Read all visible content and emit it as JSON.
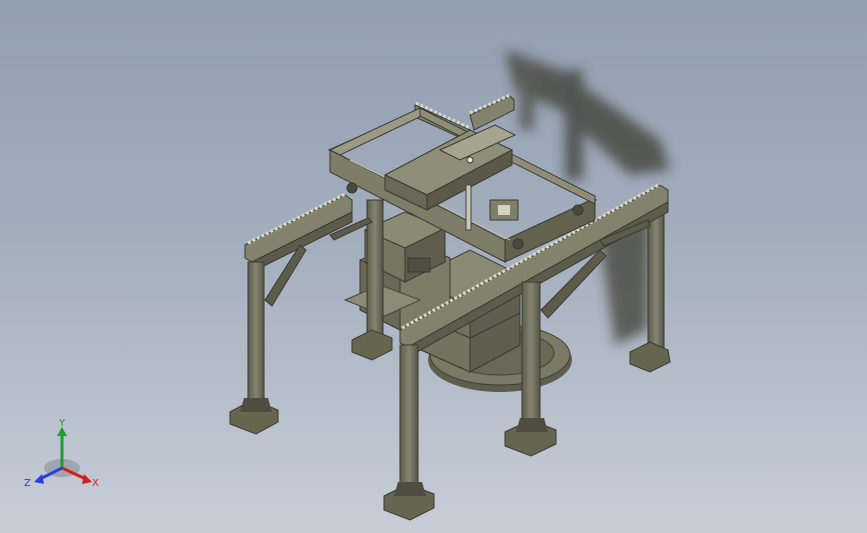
{
  "viewport": {
    "background_top": "#929fb1",
    "background_bottom": "#c7ced8"
  },
  "model": {
    "steel_color": "#6f6f5e",
    "steel_dark": "#4c4c40",
    "steel_light": "#8e8d78"
  },
  "triad": {
    "x_label": "X",
    "y_label": "Y",
    "z_label": "Z",
    "x_color": "#d21f1f",
    "y_color": "#1f9d2a",
    "z_color": "#2b3fd6"
  }
}
